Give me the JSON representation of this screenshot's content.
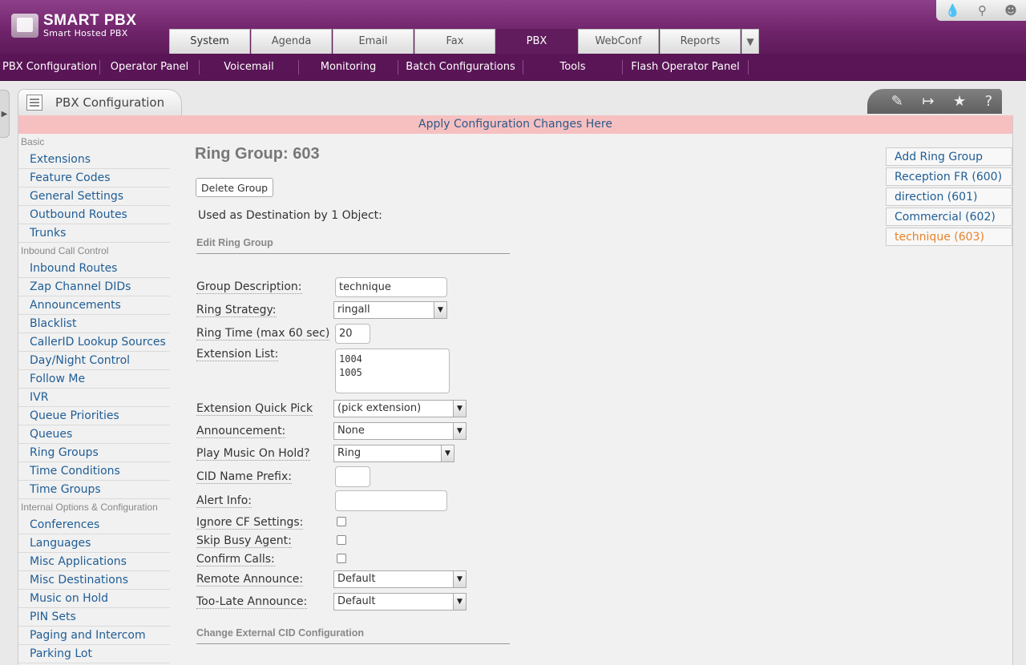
{
  "logo": {
    "title": "SMART PBX",
    "subtitle": "Smart Hosted PBX"
  },
  "tabs": [
    {
      "label": "System"
    },
    {
      "label": "Agenda"
    },
    {
      "label": "Email"
    },
    {
      "label": "Fax"
    },
    {
      "label": "PBX",
      "active": true
    },
    {
      "label": "WebConf"
    },
    {
      "label": "Reports"
    }
  ],
  "top_icons": [
    "drop-icon",
    "search-icon",
    "user-icon"
  ],
  "subnav": [
    {
      "label": "PBX Configuration"
    },
    {
      "label": "Operator Panel"
    },
    {
      "label": "Voicemail"
    },
    {
      "label": "Monitoring"
    },
    {
      "label": "Batch Configurations"
    },
    {
      "label": "Tools"
    },
    {
      "label": "Flash Operator Panel"
    }
  ],
  "panel": {
    "title": "PBX Configuration",
    "tools": [
      "edit-icon",
      "export-icon",
      "star-icon",
      "help-icon"
    ]
  },
  "apply_bar": "Apply Configuration Changes Here",
  "sidebar": {
    "sections": [
      {
        "title": "Basic",
        "items": [
          "Extensions",
          "Feature Codes",
          "General Settings",
          "Outbound Routes",
          "Trunks"
        ]
      },
      {
        "title": "Inbound Call Control",
        "items": [
          "Inbound Routes",
          "Zap Channel DIDs",
          "Announcements",
          "Blacklist",
          "CallerID Lookup Sources",
          "Day/Night Control",
          "Follow Me",
          "IVR",
          "Queue Priorities",
          "Queues",
          "Ring Groups",
          "Time Conditions",
          "Time Groups"
        ]
      },
      {
        "title": "Internal Options & Configuration",
        "items": [
          "Conferences",
          "Languages",
          "Misc Applications",
          "Misc Destinations",
          "Music on Hold",
          "PIN Sets",
          "Paging and Intercom",
          "Parking Lot"
        ]
      }
    ]
  },
  "main": {
    "title": "Ring Group: 603",
    "delete_label": "Delete Group",
    "used_as": "Used as Destination by 1 Object:",
    "section_edit": "Edit Ring Group",
    "section_cid": "Change External CID Configuration",
    "fields": {
      "group_description": {
        "label": "Group Description:",
        "value": "technique"
      },
      "ring_strategy": {
        "label": "Ring Strategy:",
        "value": "ringall"
      },
      "ring_time": {
        "label": "Ring Time (max 60 sec)",
        "value": "20"
      },
      "extension_list": {
        "label": "Extension List:",
        "value": "1004\n1005"
      },
      "quick_pick": {
        "label": "Extension Quick Pick",
        "value": "(pick extension)"
      },
      "announcement": {
        "label": "Announcement:",
        "value": "None"
      },
      "music_on_hold": {
        "label": "Play Music On Hold?",
        "value": "Ring"
      },
      "cid_prefix": {
        "label": "CID Name Prefix:",
        "value": ""
      },
      "alert_info": {
        "label": "Alert Info:",
        "value": ""
      },
      "ignore_cf": {
        "label": "Ignore CF Settings:",
        "checked": false
      },
      "skip_busy": {
        "label": "Skip Busy Agent:",
        "checked": false
      },
      "confirm_calls": {
        "label": "Confirm Calls:",
        "checked": false
      },
      "remote_announce": {
        "label": "Remote Announce:",
        "value": "Default"
      },
      "too_late_announce": {
        "label": "Too-Late Announce:",
        "value": "Default"
      }
    }
  },
  "right_list": [
    {
      "label": "Add Ring Group"
    },
    {
      "label": "Reception FR (600)"
    },
    {
      "label": "direction (601)"
    },
    {
      "label": "Commercial (602)"
    },
    {
      "label": "technique (603)",
      "current": true
    }
  ]
}
